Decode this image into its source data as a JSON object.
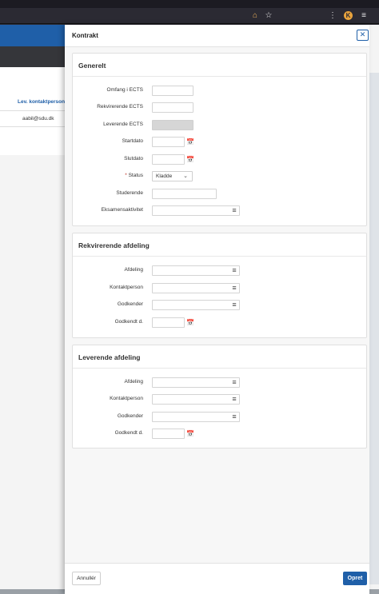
{
  "browser": {
    "icons": [
      "home-icon",
      "star-icon",
      "library-icon",
      "extension-icon",
      "menu-icon"
    ]
  },
  "background": {
    "column_header": "Lev. kontaktperson",
    "cell_value": "aabil@sdu.dk"
  },
  "dialog": {
    "title": "Kontrakt",
    "close_icon": "close-icon",
    "sections": {
      "generelt": {
        "title": "Generelt",
        "fields": {
          "omfang": {
            "label": "Omfang i ECTS",
            "value": ""
          },
          "rekvirerende_ects": {
            "label": "Rekvirerende ECTS",
            "value": ""
          },
          "leverende_ects": {
            "label": "Leverende ECTS",
            "value": ""
          },
          "startdato": {
            "label": "Startdato",
            "value": ""
          },
          "slutdato": {
            "label": "Slutdato",
            "value": ""
          },
          "status": {
            "label": "Status",
            "required_mark": "*",
            "value": "Kladde"
          },
          "studerende": {
            "label": "Studerende",
            "value": ""
          },
          "eksamensaktivitet": {
            "label": "Eksamensaktivitet",
            "value": ""
          }
        }
      },
      "rekvirerende": {
        "title": "Rekvirerende afdeling",
        "fields": {
          "afdeling": {
            "label": "Afdeling",
            "value": ""
          },
          "kontaktperson": {
            "label": "Kontaktperson",
            "value": ""
          },
          "godkender": {
            "label": "Godkender",
            "value": ""
          },
          "godkendt": {
            "label": "Godkendt d.",
            "value": ""
          }
        }
      },
      "leverende": {
        "title": "Leverende afdeling",
        "fields": {
          "afdeling": {
            "label": "Afdeling",
            "value": ""
          },
          "kontaktperson": {
            "label": "Kontaktperson",
            "value": ""
          },
          "godkender": {
            "label": "Godkender",
            "value": ""
          },
          "godkendt": {
            "label": "Godkendt d.",
            "value": ""
          }
        }
      }
    },
    "footer": {
      "cancel_label": "Annullér",
      "create_label": "Opret"
    }
  },
  "colors": {
    "accent": "#1f5fa8",
    "required": "#c0392b"
  }
}
